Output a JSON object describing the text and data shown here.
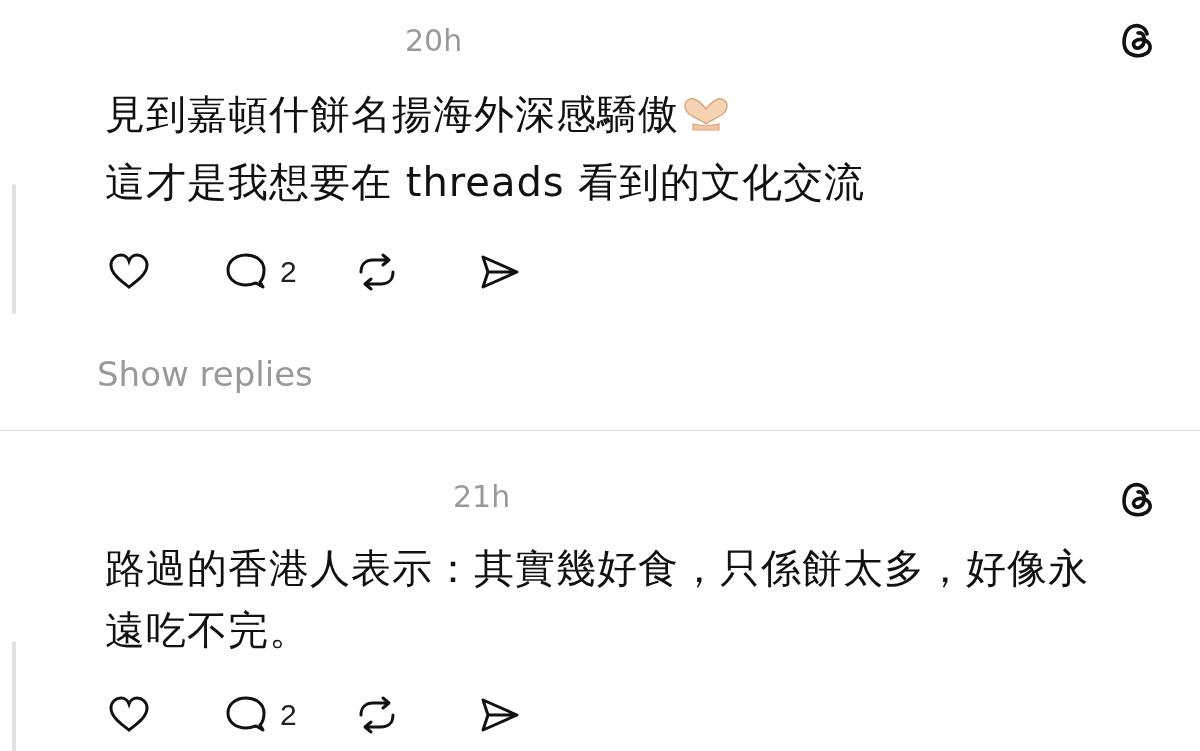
{
  "posts": [
    {
      "time": "20h",
      "text": [
        "見到嘉頓什餅名揚海外深感驕傲",
        "這才是我想要在 threads 看到的文化交流"
      ],
      "heart_hands": true,
      "reply_count": "2",
      "show_replies": "Show replies"
    },
    {
      "time": "21h",
      "text": [
        "路過的香港人表示：其實幾好食，只係餅太多，好像永遠吃不完。"
      ],
      "heart_hands": false,
      "reply_count": "2"
    }
  ]
}
